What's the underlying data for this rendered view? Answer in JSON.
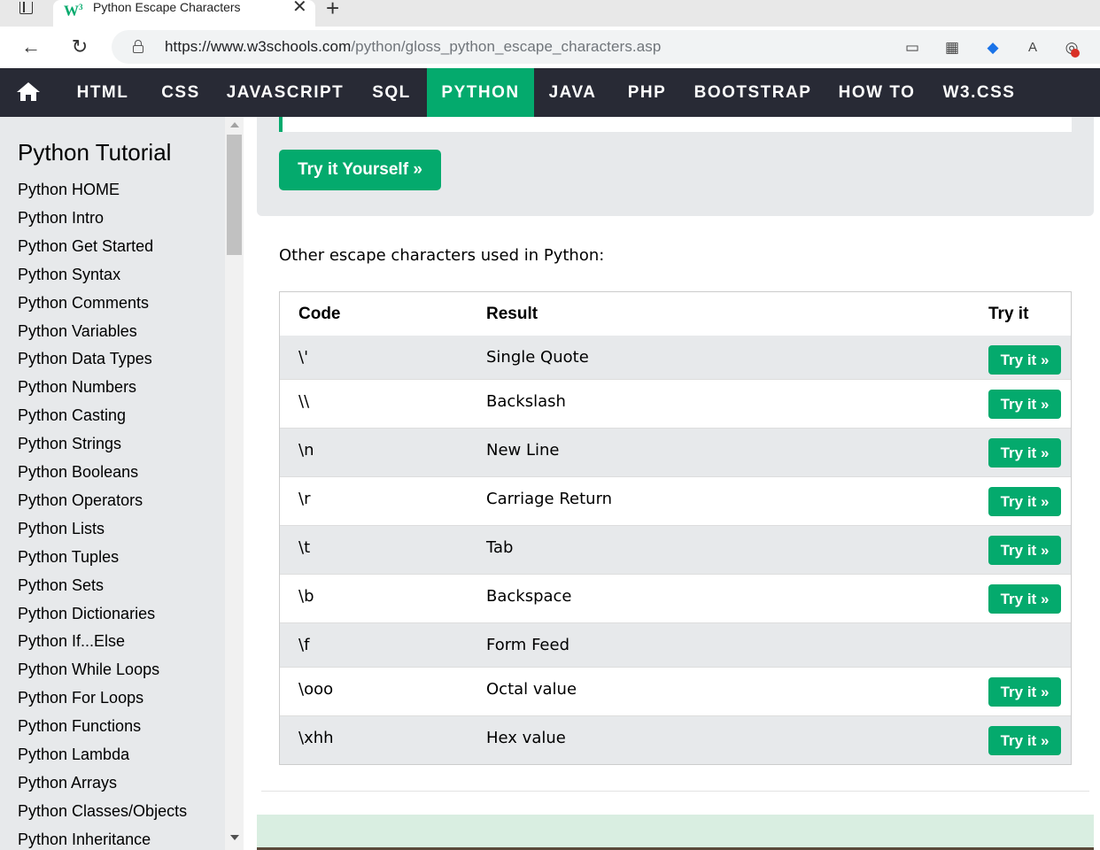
{
  "browser": {
    "tab_title": "Python Escape Characters",
    "favicon_text": "W",
    "favicon_sup": "3",
    "tab_close": "✕",
    "new_tab": "+",
    "url_host": "https://www.w3schools.com",
    "url_path": "/python/gloss_python_escape_characters.asp",
    "icons": [
      "tab-actions-icon",
      "back-icon",
      "reload-icon",
      "lock-icon",
      "device-icon",
      "apps-icon",
      "tag-icon",
      "read-aloud-icon",
      "cookie-icon"
    ]
  },
  "topnav": {
    "items": [
      {
        "label": "HTML",
        "active": false
      },
      {
        "label": "CSS",
        "active": false
      },
      {
        "label": "JAVASCRIPT",
        "active": false
      },
      {
        "label": "SQL",
        "active": false
      },
      {
        "label": "PYTHON",
        "active": true
      },
      {
        "label": "JAVA",
        "active": false
      },
      {
        "label": "PHP",
        "active": false
      },
      {
        "label": "BOOTSTRAP",
        "active": false
      },
      {
        "label": "HOW TO",
        "active": false
      },
      {
        "label": "W3.CSS",
        "active": false
      }
    ],
    "active_color": "#04aa6d",
    "bg_color": "#282a35"
  },
  "sidebar": {
    "title": "Python Tutorial",
    "items": [
      "Python HOME",
      "Python Intro",
      "Python Get Started",
      "Python Syntax",
      "Python Comments",
      "Python Variables",
      "Python Data Types",
      "Python Numbers",
      "Python Casting",
      "Python Strings",
      "Python Booleans",
      "Python Operators",
      "Python Lists",
      "Python Tuples",
      "Python Sets",
      "Python Dictionaries",
      "Python If...Else",
      "Python While Loops",
      "Python For Loops",
      "Python Functions",
      "Python Lambda",
      "Python Arrays",
      "Python Classes/Objects",
      "Python Inheritance"
    ]
  },
  "main": {
    "try_yourself_label": "Try it Yourself »",
    "intro": "Other escape characters used in Python:",
    "table": {
      "headers": [
        "Code",
        "Result",
        "Try it"
      ],
      "rows": [
        {
          "code": "\\'",
          "result": "Single Quote",
          "try": "Try it »"
        },
        {
          "code": "\\\\",
          "result": "Backslash",
          "try": "Try it »"
        },
        {
          "code": "\\n",
          "result": "New Line",
          "try": "Try it »"
        },
        {
          "code": "\\r",
          "result": "Carriage Return",
          "try": "Try it »"
        },
        {
          "code": "\\t",
          "result": "Tab",
          "try": "Try it »"
        },
        {
          "code": "\\b",
          "result": "Backspace",
          "try": "Try it »"
        },
        {
          "code": "\\f",
          "result": "Form Feed",
          "try": null
        },
        {
          "code": "\\ooo",
          "result": "Octal value",
          "try": "Try it »"
        },
        {
          "code": "\\xhh",
          "result": "Hex value",
          "try": "Try it »"
        }
      ]
    },
    "button_color": "#04aa6d"
  }
}
